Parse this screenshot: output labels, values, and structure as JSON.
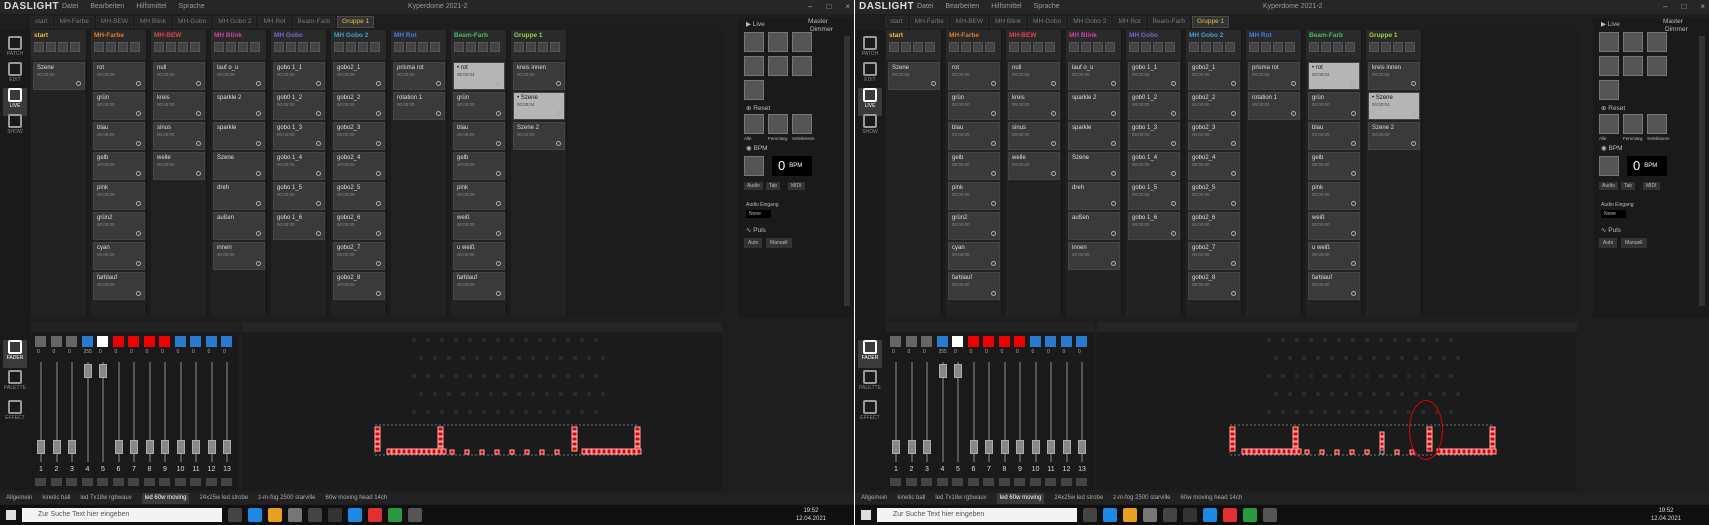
{
  "app": {
    "logo": "DASLIGHT",
    "menu": [
      "Datei",
      "Bearbeiten",
      "Hilfsmittel",
      "Sprache"
    ],
    "window_title": "Kyperdome 2021-2",
    "window_buttons": [
      "–",
      "□",
      "×"
    ]
  },
  "tabs": [
    "start",
    "MH-Farbe",
    "MH-BEW",
    "MH Blink",
    "MH-Gobo",
    "MH Gobo 2",
    "MH Rot",
    "Beam-Farb",
    "Gruppe 1"
  ],
  "left_nav": [
    "PATCH",
    "EDIT",
    "LIVE",
    "SHOW"
  ],
  "fader_nav": [
    "FADER",
    "PALETTE",
    "EFFECT"
  ],
  "columns": [
    {
      "name": "start",
      "color": "#e8c040",
      "cues": [
        {
          "label": "Szene",
          "time": "00:00:00"
        }
      ]
    },
    {
      "name": "MH-Farbe",
      "color": "#e07a30",
      "cues": [
        {
          "label": "rot",
          "time": "00:00:00"
        },
        {
          "label": "grün",
          "time": "00:00:00"
        },
        {
          "label": "blau",
          "time": "00:00:00"
        },
        {
          "label": "gelb",
          "time": "00:00:00"
        },
        {
          "label": "pink",
          "time": "00:00:00"
        },
        {
          "label": "grün2",
          "time": "00:00:00"
        },
        {
          "label": "cyan",
          "time": "00:00:00"
        },
        {
          "label": "farblauf",
          "time": "00:00:00"
        }
      ]
    },
    {
      "name": "MH-BEW",
      "color": "#e04050",
      "cues": [
        {
          "label": "null",
          "time": "00:00:00"
        },
        {
          "label": "kreis",
          "time": "00:00:00"
        },
        {
          "label": "sinus",
          "time": "00:00:00"
        },
        {
          "label": "welle",
          "time": "00:00:00"
        }
      ]
    },
    {
      "name": "MH Blink",
      "color": "#d040a0",
      "cues": [
        {
          "label": "lauf o_u",
          "time": "00:00:00"
        },
        {
          "label": "sparkle 2",
          "time": ""
        },
        {
          "label": "sparkle",
          "time": ""
        },
        {
          "label": "Szene",
          "time": ""
        },
        {
          "label": "dreh",
          "time": ""
        },
        {
          "label": "außen",
          "time": ""
        },
        {
          "label": "innen",
          "time": "00:00:00"
        }
      ]
    },
    {
      "name": "MH Gobo",
      "color": "#8060d0",
      "cues": [
        {
          "label": "gobo 1_1",
          "time": "00:00:00"
        },
        {
          "label": "gob0 1_2",
          "time": "00:00:00"
        },
        {
          "label": "gobo 1_3",
          "time": "00:00:00"
        },
        {
          "label": "gobo 1_4",
          "time": "00:00:00"
        },
        {
          "label": "gobo 1_5",
          "time": "00:00:00"
        },
        {
          "label": "gobo 1_6",
          "time": "00:00:00"
        }
      ]
    },
    {
      "name": "MH Gobo 2",
      "color": "#40a0d0",
      "cues": [
        {
          "label": "gobo2_1",
          "time": "00:00:00"
        },
        {
          "label": "gobo2_2",
          "time": "00:00:00"
        },
        {
          "label": "gobo2_3",
          "time": "00:00:00"
        },
        {
          "label": "gobo2_4",
          "time": "00:00:00"
        },
        {
          "label": "gobo2_5",
          "time": "00:00:00"
        },
        {
          "label": "gobo2_6",
          "time": "00:00:00"
        },
        {
          "label": "gobo2_7",
          "time": "00:00:00"
        },
        {
          "label": "gobo2_8",
          "time": "00:00:00"
        }
      ]
    },
    {
      "name": "MH Rot",
      "color": "#4080e0",
      "cues": [
        {
          "label": "prisma rot",
          "time": "00:00:00"
        },
        {
          "label": "rotation 1",
          "time": "00:00:00"
        }
      ]
    },
    {
      "name": "Beam-Farb",
      "color": "#40c060",
      "cues": [
        {
          "label": "rot",
          "time": "00:00:04",
          "on": true
        },
        {
          "label": "grün",
          "time": "00:00:00"
        },
        {
          "label": "blau",
          "time": "00:00:00"
        },
        {
          "label": "gelb",
          "time": "00:00:00"
        },
        {
          "label": "pink",
          "time": "00:00:00"
        },
        {
          "label": "weiß",
          "time": "00:00:00"
        },
        {
          "label": "u weiß",
          "time": "00:00:00"
        },
        {
          "label": "farblauf",
          "time": "00:00:00"
        }
      ]
    },
    {
      "name": "Gruppe 1",
      "color": "#a0d040",
      "cues": [
        {
          "label": "kreis innen",
          "time": "00:00:00"
        },
        {
          "label": "Szene",
          "time": "00:00:04",
          "on": true
        },
        {
          "label": "Szene 2",
          "time": "00:00:00"
        }
      ]
    }
  ],
  "right_panel": {
    "live": "Live",
    "master": "Master",
    "dimmer": "Dimmer",
    "reset": "Reset",
    "grid_labels": [
      "Alle",
      "Fernmärg",
      "Selektieren"
    ],
    "bpm_label": "BPM",
    "bpm_value": "0",
    "bpm_unit": "BPM",
    "bpm_sources": [
      "Audio",
      "Tab",
      "MIDI"
    ],
    "audio_label": "Audio Eingang",
    "audio_value": "None",
    "puls": "Puls",
    "puls_sources": [
      "Auto",
      "Manuell"
    ]
  },
  "faders": {
    "numbers": [
      "1",
      "2",
      "3",
      "4",
      "5",
      "6",
      "7",
      "8",
      "9",
      "10",
      "11",
      "12",
      "13"
    ],
    "values": [
      "0",
      "0",
      "0",
      "255",
      "0",
      "0",
      "0",
      "0",
      "0",
      "0",
      "0",
      "0",
      "0"
    ],
    "button_colors": [
      "#666",
      "#666",
      "#666",
      "#2a7ad0",
      "#fff",
      "#e00",
      "#e00",
      "#e00",
      "#e00",
      "#2a7ad0",
      "#2a7ad0",
      "#2a7ad0",
      "#2a7ad0"
    ]
  },
  "status_tabs": [
    "Allgemein",
    "kinetic ball",
    "led 7x18w rgbwauv",
    "led 60w moving",
    "24x25w led strobe",
    "z-m-fog 2500 starville",
    "60w moving head 14ch"
  ],
  "taskbar": {
    "search_placeholder": "Zur Suche Text hier eingeben",
    "time": "19:52",
    "date": "12.04.2021"
  }
}
